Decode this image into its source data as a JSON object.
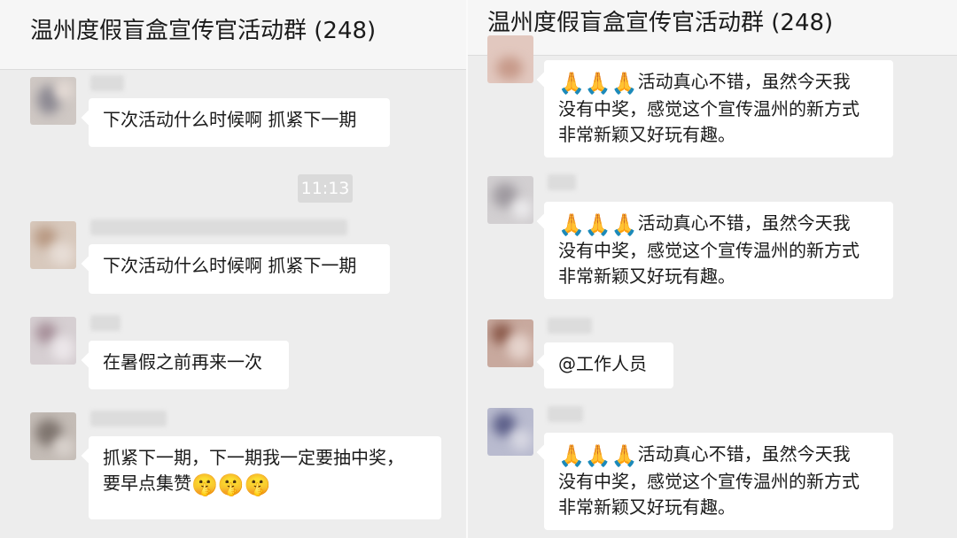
{
  "left_panel": {
    "group_title": "温州度假盲盒宣传官活动群 (248)",
    "time_divider": "11:13",
    "messages": [
      {
        "lines": [
          "下次活动什么时候啊 抓紧下一期"
        ]
      },
      {
        "lines": [
          "下次活动什么时候啊 抓紧下一期"
        ]
      },
      {
        "lines": [
          "在暑假之前再来一次"
        ]
      },
      {
        "lines": [
          "抓紧下一期，下一期我一定要抽中奖，",
          "要早点集赞"
        ],
        "emoji": "🤫🤫🤫"
      }
    ]
  },
  "right_panel": {
    "group_title": "温州度假盲盒宣传官活动群 (248)",
    "messages": [
      {
        "emoji": "🙏🙏🙏",
        "lines": [
          "活动真心不错，虽然今天我",
          "没有中奖，感觉这个宣传温州的新方式",
          "非常新颖又好玩有趣。"
        ]
      },
      {
        "emoji": "🙏🙏🙏",
        "lines": [
          "活动真心不错，虽然今天我",
          "没有中奖，感觉这个宣传温州的新方式",
          "非常新颖又好玩有趣。"
        ]
      },
      {
        "lines": [
          "@工作人员"
        ]
      },
      {
        "emoji": "🙏🙏🙏",
        "lines": [
          "活动真心不错，虽然今天我",
          "没有中奖，感觉这个宣传温州的新方式",
          "非常新颖又好玩有趣。"
        ]
      }
    ]
  },
  "icons": {
    "pray": "folded-hands-emoji",
    "shush": "shushing-face-emoji"
  }
}
